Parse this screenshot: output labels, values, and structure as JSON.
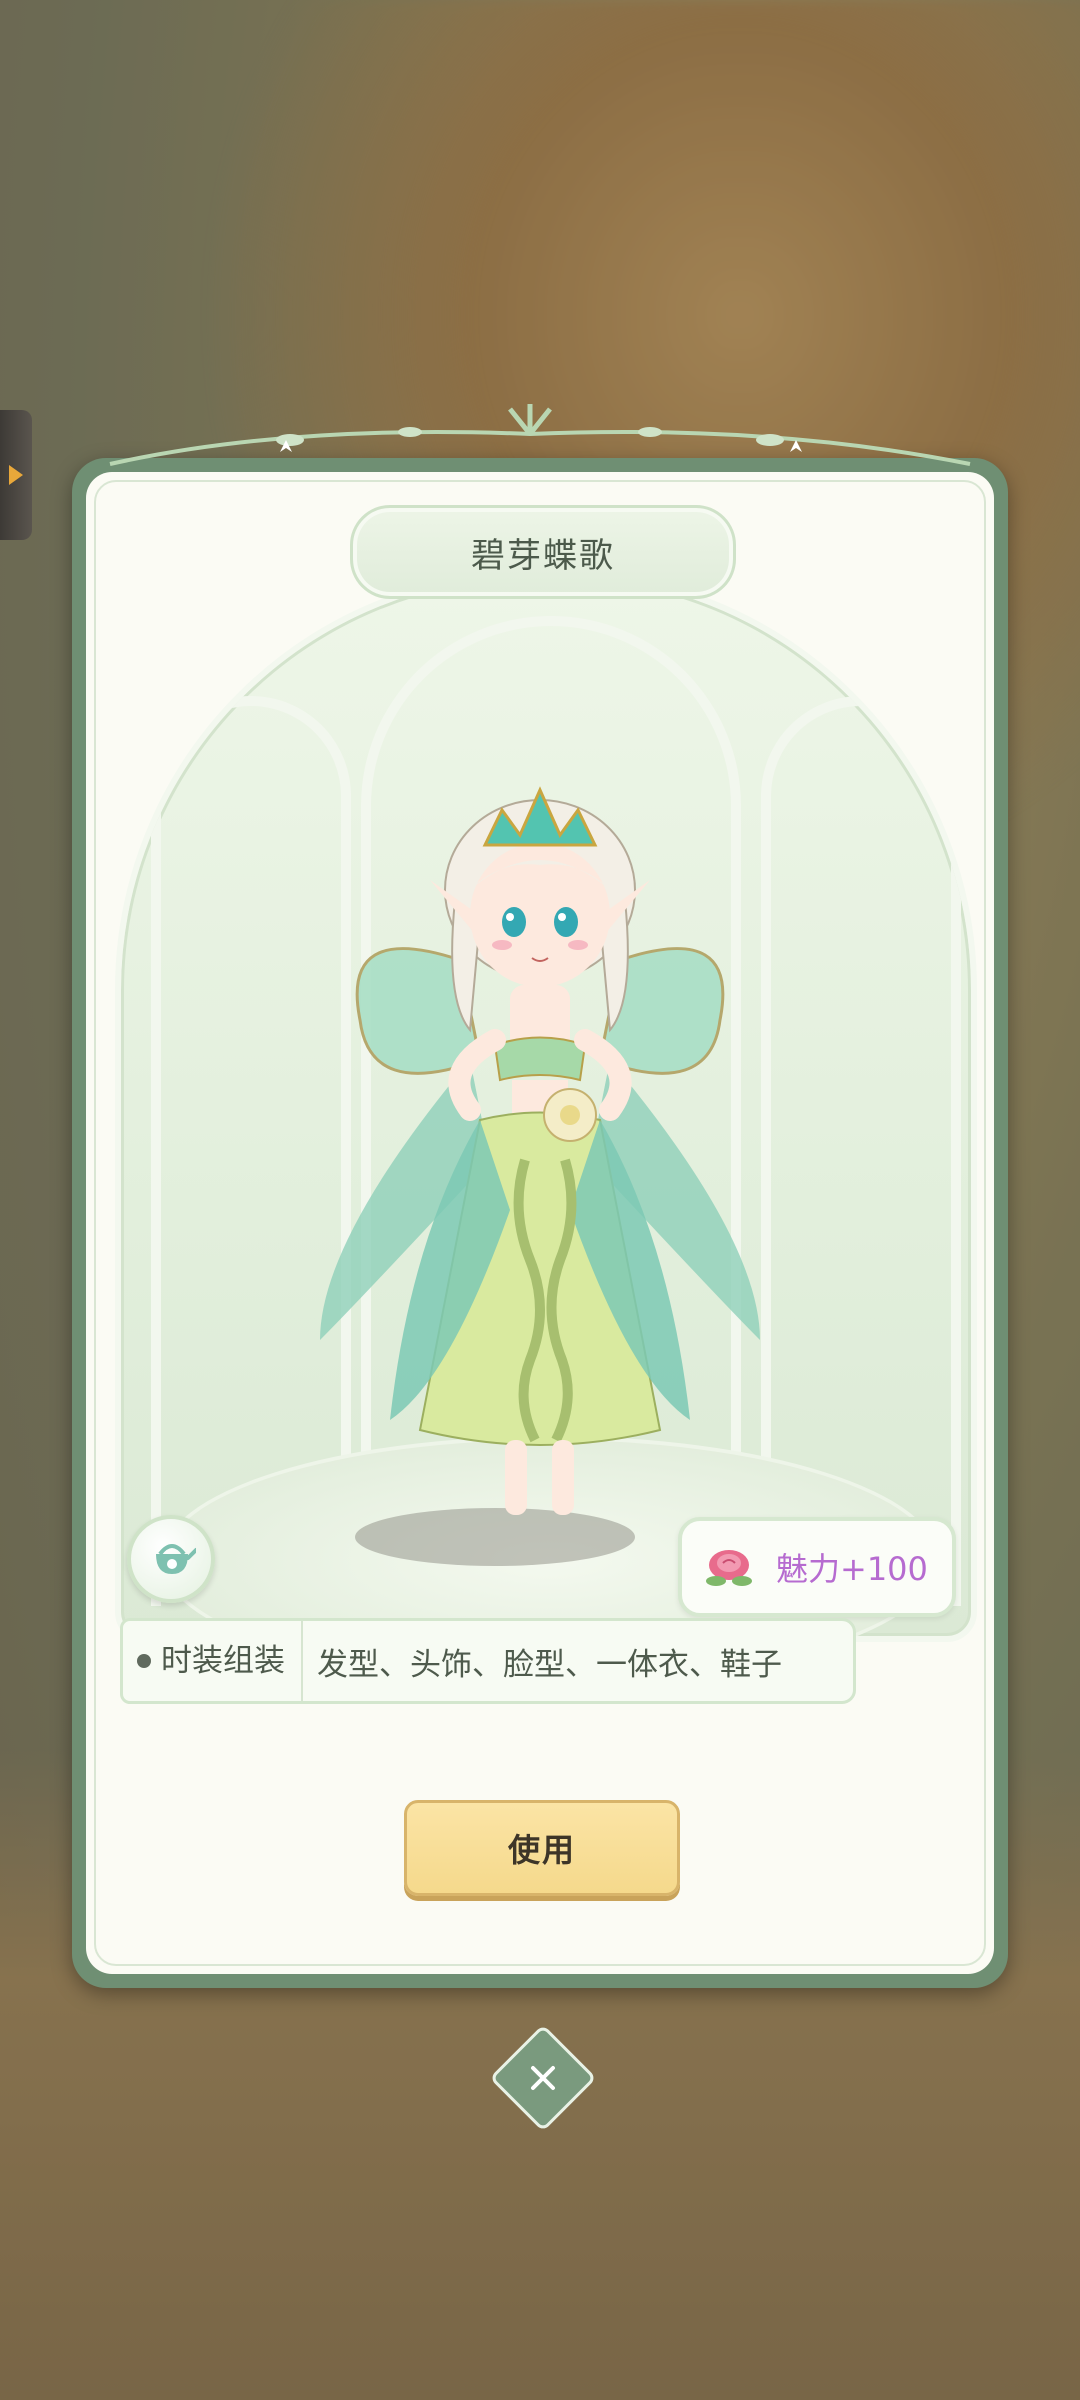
{
  "card": {
    "title": "碧芽蝶歌",
    "charm_text": "魅力+100",
    "info": {
      "label": "时装组装",
      "value": "发型、头饰、脸型、一体衣、鞋子"
    },
    "use_button_label": "使用"
  },
  "icons": {
    "side_tab": "arrow-right-icon",
    "watering": "watering-can-icon",
    "charm": "rose-icon",
    "close": "close-icon"
  },
  "colors": {
    "frame": "#6f8f73",
    "panel": "#fbfbf4",
    "charm_text": "#b66bd0",
    "button": "#f5d98c"
  }
}
